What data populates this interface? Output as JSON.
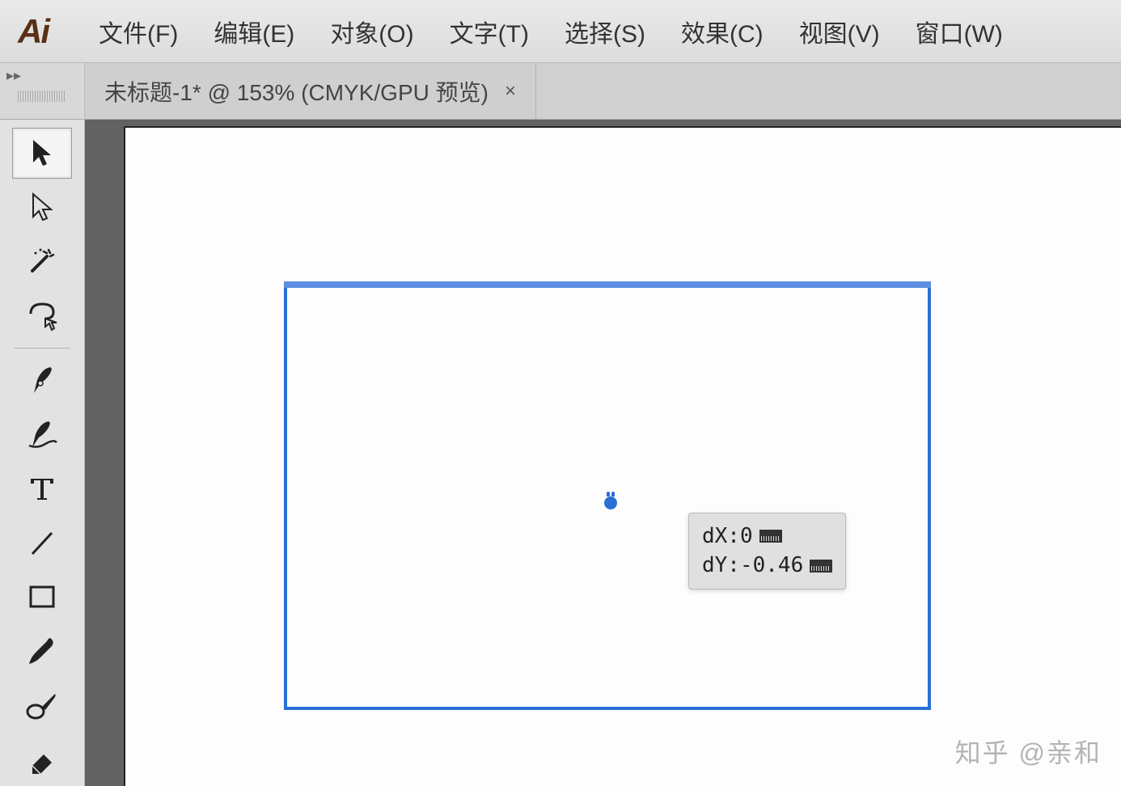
{
  "app": {
    "logo_text": "Ai"
  },
  "menus": {
    "file": "文件(F)",
    "edit": "编辑(E)",
    "object": "对象(O)",
    "type": "文字(T)",
    "select": "选择(S)",
    "effect": "效果(C)",
    "view": "视图(V)",
    "window": "窗口(W)"
  },
  "document": {
    "tab_title": "未标题-1* @ 153% (CMYK/GPU 预览)",
    "close_label": "×"
  },
  "measurement": {
    "dx_label": "dX:",
    "dx_value": "0",
    "dy_label": "dY:",
    "dy_value": "-0.46"
  },
  "watermark": "知乎 @亲和"
}
